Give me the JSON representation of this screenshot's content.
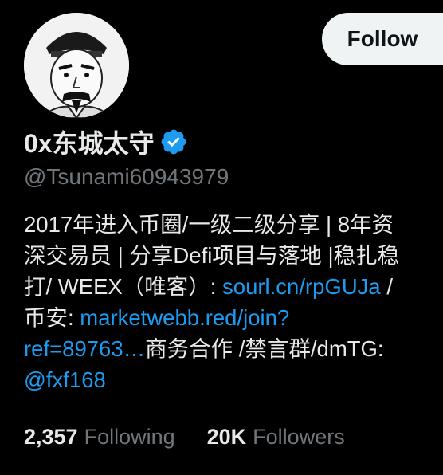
{
  "profile": {
    "display_name": "0x东城太守",
    "handle": "@Tsunami60943979",
    "follow_label": "Follow",
    "verified_color": "#1d9bf0",
    "avatar_icon": "avatar-portrait-icon",
    "bio": {
      "line1": "2017年进入币圈/一级二级分享 | 8年资",
      "line2": "深交易员 | 分享Defi项目与落地 |稳扎稳",
      "line3_text": "打/ WEEX（唯客）: ",
      "link1": "sourl.cn/rpGUJa",
      "line3_tail": " /",
      "line4_text": "币安: ",
      "link2a": "marketwebb.red/join?",
      "link2b": "ref=89763…",
      "line5_tail": "商务合作 /禁言群/dmTG:",
      "link3": "@fxf168"
    },
    "stats": {
      "following_count": "2,357",
      "following_label": "Following",
      "followers_count": "20K",
      "followers_label": "Followers"
    }
  }
}
